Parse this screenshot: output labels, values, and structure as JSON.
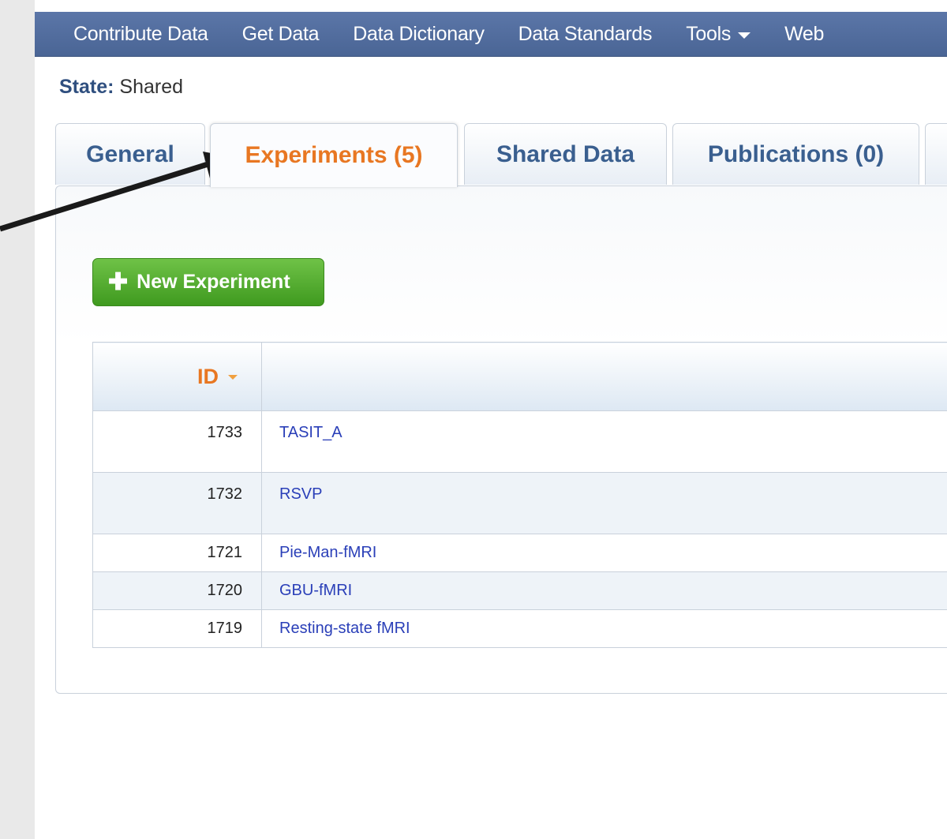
{
  "nav": {
    "items": [
      {
        "label": "Contribute Data"
      },
      {
        "label": "Get Data"
      },
      {
        "label": "Data Dictionary"
      },
      {
        "label": "Data Standards"
      },
      {
        "label": "Tools",
        "dropdown": true
      },
      {
        "label": "Web"
      }
    ]
  },
  "state": {
    "label": "State:",
    "value": "Shared"
  },
  "tabs": [
    {
      "label": "General",
      "active": false
    },
    {
      "label": "Experiments (5)",
      "active": true
    },
    {
      "label": "Shared Data",
      "active": false
    },
    {
      "label": "Publications (0)",
      "active": false
    }
  ],
  "new_experiment_button": {
    "label": "New Experiment",
    "icon": "plus-icon"
  },
  "table": {
    "header": {
      "id": "ID",
      "name": ""
    },
    "rows": [
      {
        "id": "1733",
        "name": "TASIT_A"
      },
      {
        "id": "1732",
        "name": "RSVP"
      },
      {
        "id": "1721",
        "name": "Pie-Man-fMRI"
      },
      {
        "id": "1720",
        "name": "GBU-fMRI"
      },
      {
        "id": "1719",
        "name": "Resting-state fMRI"
      }
    ]
  },
  "colors": {
    "nav_bg": "#4f6a9b",
    "active_tab": "#e87722",
    "tab_text": "#3a5f8f",
    "button_green": "#4caf28",
    "link_blue": "#2a3fb8"
  }
}
